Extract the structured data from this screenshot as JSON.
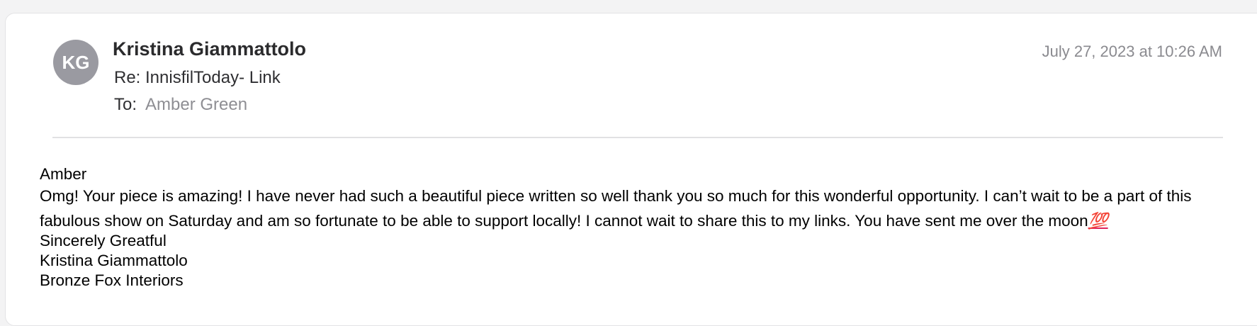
{
  "email": {
    "avatar_initials": "KG",
    "sender": "Kristina Giammattolo",
    "date": "July 27, 2023 at 10:26 AM",
    "subject": "Re: InnisfilToday- Link",
    "to_label": "To:",
    "to_value": "Amber Green"
  },
  "body": {
    "greeting": "Amber",
    "paragraph": "Omg!  Your piece is amazing! I have never had such a beautiful piece written so well thank you so much for this wonderful opportunity.  I can’t wait to be a part of this fabulous show on Saturday and am so fortunate to be able to support locally! I cannot wait to share this to my links. You have sent me over the moon",
    "emoji": "💯",
    "closing": "Sincerely Greatful",
    "signature_name": "Kristina Giammattolo",
    "signature_company": "Bronze Fox Interiors"
  },
  "colors": {
    "avatar": "#9a9aa1",
    "emoji": "#e0245e"
  }
}
